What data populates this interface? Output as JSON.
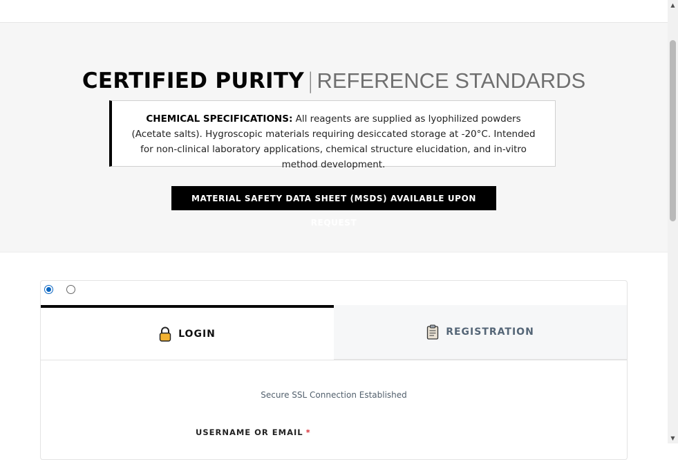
{
  "hero": {
    "title_strong": "CERTIFIED PURITY",
    "title_separator": "|",
    "title_light": "REFERENCE STANDARDS",
    "spec_label": "CHEMICAL SPECIFICATIONS:",
    "spec_text": "All reagents are supplied as lyophilized powders (Acetate salts). Hygroscopic materials requiring desiccated storage at -20°C. Intended for non-clinical laboratory applications, chemical structure elucidation, and in-vitro method development.",
    "msds_button": "MATERIAL SAFETY DATA SHEET (MSDS) AVAILABLE UPON REQUEST"
  },
  "auth": {
    "radio_login_selected": true,
    "radio_register_selected": false,
    "tabs": [
      {
        "label": "LOGIN",
        "icon": "lock-icon",
        "active": true
      },
      {
        "label": "REGISTRATION",
        "icon": "clipboard-icon",
        "active": false
      }
    ],
    "ssl_note": "Secure SSL Connection Established",
    "username_label": "USERNAME OR EMAIL",
    "required_mark": "*"
  },
  "colors": {
    "accent_blue": "#0a66c2",
    "black": "#000000",
    "required_red": "#d9363e",
    "lock_gold": "#f2b233"
  }
}
